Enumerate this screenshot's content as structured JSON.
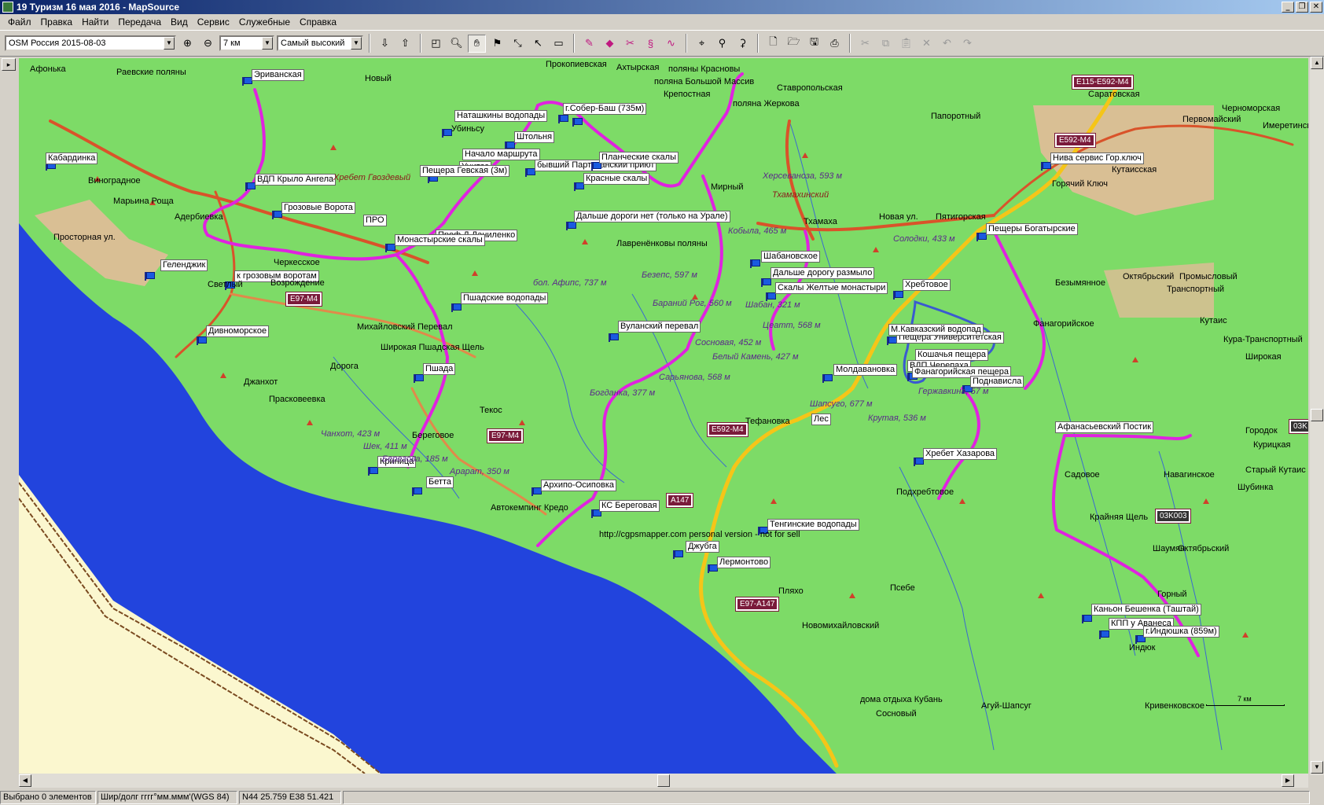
{
  "window": {
    "title": "19 Туризм 16 мая 2016 - MapSource"
  },
  "menu": [
    "Файл",
    "Правка",
    "Найти",
    "Передача",
    "Вид",
    "Сервис",
    "Служебные",
    "Справка"
  ],
  "toolbar": {
    "map_product": "OSM Россия 2015-08-03",
    "zoom_level": "7 км",
    "detail_level": "Самый высокий"
  },
  "statusbar": {
    "selection": "Выбрано 0 элементов",
    "format": "Шир/долг гггг°мм.ммм'(WGS 84)",
    "coords": "N44 25.759 E38 51.421"
  },
  "map": {
    "scale_label": "7 км",
    "watermark": "http://cgpsmapper.com personal version - not for sell",
    "colors": {
      "land": "#7ddb67",
      "sea": "#2244dd",
      "beach": "#fbf7cf",
      "track": "#e022e0",
      "road_major": "#d9532a",
      "road_yellow": "#f5c518"
    },
    "waypoints": [
      {
        "label": "Эриванская"
      },
      {
        "label": "Наташкины водопады"
      },
      {
        "label": "г.Собер-Баш (735м)"
      },
      {
        "label": "Убиньсу"
      },
      {
        "label": "Штольня"
      },
      {
        "label": "Начало маршрута"
      },
      {
        "label": "Унитаз"
      },
      {
        "label": "бывший Партизанский приют"
      },
      {
        "label": "Планческие скалы"
      },
      {
        "label": "Красные скалы"
      },
      {
        "label": "Пещера Гевская (3м)"
      },
      {
        "label": "ВДП Крыло Ангела"
      },
      {
        "label": "Кабардинка"
      },
      {
        "label": "Грозовые Ворота"
      },
      {
        "label": "ПРО"
      },
      {
        "label": "Дальше дороги нет (только на Урале)"
      },
      {
        "label": "Проф.Д.Даниленко"
      },
      {
        "label": "Монастырские скалы"
      },
      {
        "label": "Шабановское"
      },
      {
        "label": "Дальше дорогу размыло"
      },
      {
        "label": "Скалы Желтые монастыри"
      },
      {
        "label": "Хребтовое"
      },
      {
        "label": "Геленджик"
      },
      {
        "label": "к грозовым воротам"
      },
      {
        "label": "Пшадские водопады"
      },
      {
        "label": "Вуланский перевал"
      },
      {
        "label": "Дивноморское"
      },
      {
        "label": "Пшада"
      },
      {
        "label": "Пещера Университетская"
      },
      {
        "label": "Кошачья пещера"
      },
      {
        "label": "ВДП Черепаха"
      },
      {
        "label": "Фанагорийская пещера"
      },
      {
        "label": "Молдавановка"
      },
      {
        "label": "Поднависла"
      },
      {
        "label": "Хребет Хазарова"
      },
      {
        "label": "Криница"
      },
      {
        "label": "Бетта"
      },
      {
        "label": "Архипо-Осиповка"
      },
      {
        "label": "КС Береговая"
      },
      {
        "label": "Автокемпинг Кредо"
      },
      {
        "label": "Тенгинские водопады"
      },
      {
        "label": "Джубга"
      },
      {
        "label": "Лермонтово"
      },
      {
        "label": "Нива сервис Гор.ключ"
      },
      {
        "label": "Пещеры Богатырские"
      },
      {
        "label": "Каньон Бешенка (Таштай)"
      },
      {
        "label": "КПП у Аванеса"
      },
      {
        "label": "г.Индюшка (859м)"
      },
      {
        "label": "М.Кавказский водопад"
      },
      {
        "label": "Лес"
      }
    ],
    "places": [
      "Афонька",
      "Раевские поляны",
      "Новый",
      "Виноградное",
      "Марьина Роща",
      "Адербиевка",
      "Просторная ул.",
      "Черкесское",
      "Возрождение",
      "Светлый",
      "Михайловский Перевал",
      "Широкая Пшадская Щель",
      "Дорога",
      "Джанхот",
      "Прасковеевка",
      "Береговое",
      "Текос",
      "Чанхот, 423 м",
      "Шек, 411 м",
      "Тхамаха",
      "Новая ул.",
      "Пятигорская",
      "Солодки, 433 м",
      "Безымянное",
      "Октябрьский",
      "Промысловый",
      "Транспортный",
      "Кутаис",
      "Кура-Транспортный",
      "Фанагорийское",
      "Широкая",
      "Городок",
      "Курицкая",
      "Старый Кутаис",
      "Шубинка",
      "Навагинское",
      "Садовое",
      "Крайняя Щель",
      "Шаумян",
      "Октябрьский",
      "Горный",
      "Индюк",
      "Пляхо",
      "Новомихайловский",
      "Псебе",
      "Агуй-Шапсуг",
      "Сосновый",
      "дома отдыха Кубань",
      "Кривенковское",
      "Подхребтовое",
      "Шапсуго, 677 м",
      "Крутая, 536 м",
      "Гержавкина, 57 м",
      "Тефановка",
      "Горячий Ключ",
      "Кутаисская",
      "Имеретинская",
      "Первомайский",
      "Черноморская",
      "Саратовская",
      "Папоротный",
      "Ставропольская",
      "Кобыла, 465 м",
      "Лавренёнковы поляны",
      "Безепс, 597 м",
      "Мирный",
      "Шабан, 321 м",
      "Бараний Рог, 560 м",
      "Сосновая, 452 м",
      "Белый Камень, 427 м",
      "Сарьянова, 568 м",
      "Богданка, 377 м",
      "Цеатт, 568 м",
      "бол. Афипс, 737 м",
      "Арарат, 350 м",
      "Берегова, 185 м",
      "Ахтырская",
      "Крепостная",
      "поляны Красновы",
      "поляна Большой Массив",
      "поляна Жеркова",
      "Тхамахинский",
      "Херсеваноза, 593 м",
      "Афанасьевский Постик",
      "Хребет Гвоздевый",
      "Прокопиевская"
    ],
    "roads": [
      "E115-E592-M4",
      "E592-M4",
      "E97-M4",
      "E592-M4",
      "A147",
      "E97-A147",
      "03K003",
      "03K"
    ]
  }
}
